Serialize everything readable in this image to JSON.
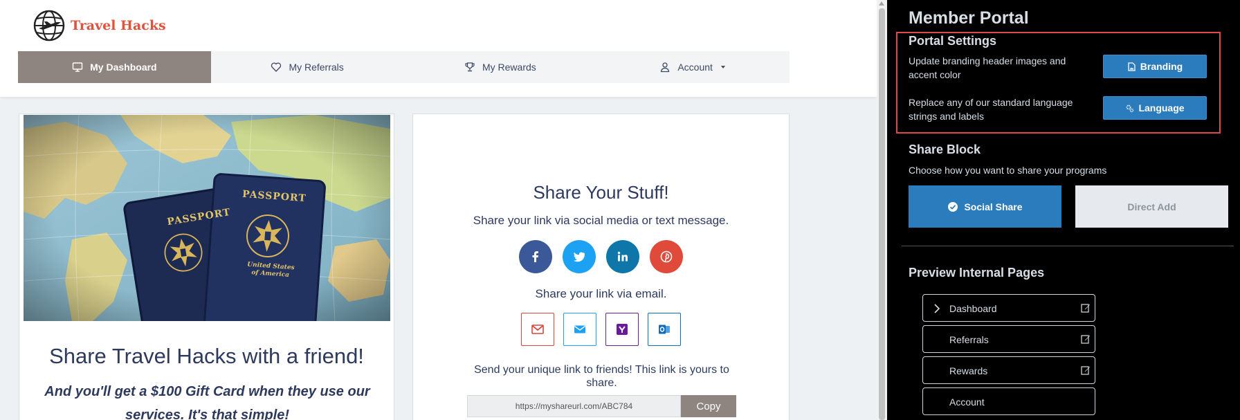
{
  "app": {
    "brand": "Travel Hacks",
    "nav": [
      {
        "label": "My Dashboard",
        "icon": "monitor-icon",
        "active": true
      },
      {
        "label": "My Referrals",
        "icon": "heart-icon",
        "active": false
      },
      {
        "label": "My Rewards",
        "icon": "trophy-icon",
        "active": false
      },
      {
        "label": "Account",
        "icon": "user-icon",
        "active": false
      }
    ],
    "hero": {
      "passport_label": "PASSPORT",
      "country_line1": "United States",
      "country_line2": "of America"
    },
    "share_card": {
      "title": "Share Travel Hacks with a friend!",
      "subtitle": "And you'll get a $100 Gift Card when they use our services. It's that simple!"
    },
    "share_stuff": {
      "title": "Share Your Stuff!",
      "social_label": "Share your link via social media or text message.",
      "email_label": "Share your link via email.",
      "unique_label": "Send your unique link to friends! This link is yours to share.",
      "link_value": "https://myshareurl.com/ABC784",
      "copy_label": "Copy",
      "social_icons": [
        {
          "name": "facebook-icon",
          "color": "#3b5998"
        },
        {
          "name": "twitter-icon",
          "color": "#1da1f2"
        },
        {
          "name": "linkedin-icon",
          "color": "#0e76a8"
        },
        {
          "name": "pinterest-icon",
          "color": "#e04a3a"
        }
      ],
      "email_icons": [
        {
          "name": "gmail-icon",
          "color": "#d9453b"
        },
        {
          "name": "mail-icon",
          "color": "#1da1f2"
        },
        {
          "name": "yahoo-icon",
          "color": "#6a1b9a"
        },
        {
          "name": "outlook-icon",
          "color": "#0f6cbd"
        }
      ]
    }
  },
  "portal": {
    "title": "Member Portal",
    "settings_title": "Portal Settings",
    "branding_desc": "Update branding header images and accent color",
    "branding_button": "Branding",
    "language_desc": "Replace any of our standard language strings and labels",
    "language_button": "Language",
    "share_block_title": "Share Block",
    "share_block_desc": "Choose how you want to share your programs",
    "social_share_label": "Social Share",
    "direct_add_label": "Direct Add",
    "preview_title": "Preview Internal Pages",
    "pages": [
      {
        "label": "Dashboard",
        "expanded": true,
        "editable": true
      },
      {
        "label": "Referrals",
        "expanded": false,
        "editable": true
      },
      {
        "label": "Rewards",
        "expanded": false,
        "editable": true
      },
      {
        "label": "Account",
        "expanded": false,
        "editable": false
      }
    ]
  },
  "colors": {
    "accent_blue": "#2b7cbd",
    "nav_active": "#8f8580",
    "brand_red": "#e0523c",
    "heading_navy": "#2d3a5e",
    "highlight_red": "#e04a4a"
  }
}
